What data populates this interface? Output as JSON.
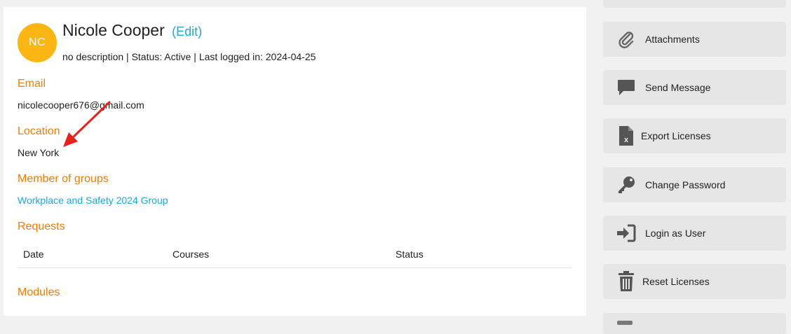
{
  "profile": {
    "initials": "NC",
    "name": "Nicole Cooper",
    "edit_open": "(",
    "edit_label": "Edit",
    "edit_close": ")",
    "meta": "no description | Status: Active | Last logged in: 2024-04-25"
  },
  "sections": {
    "email_title": "Email",
    "email_value": "nicolecooper676@gmail.com",
    "location_title": "Location",
    "location_value": "New York",
    "groups_title": "Member of groups",
    "group_link": "Workplace and Safety 2024 Group",
    "requests_title": "Requests",
    "modules_title": "Modules"
  },
  "requests_table": {
    "columns": [
      "Date",
      "Courses",
      "Status"
    ]
  },
  "sidebar": {
    "buttons": [
      {
        "label": "Attachments",
        "icon": "paperclip-icon"
      },
      {
        "label": "Send Message",
        "icon": "speech-bubble-icon"
      },
      {
        "label": "Export Licenses",
        "icon": "excel-file-icon"
      },
      {
        "label": "Change Password",
        "icon": "key-icon"
      },
      {
        "label": "Login as User",
        "icon": "sign-in-icon"
      },
      {
        "label": "Reset Licenses",
        "icon": "trash-icon"
      }
    ]
  },
  "colors": {
    "accent_orange": "#f07d00",
    "link_blue": "#1ba9dc",
    "avatar_yellow": "#fbb614",
    "annotation_arrow": "#e8201c",
    "sidebar_button_bg": "#e6e6e6"
  }
}
